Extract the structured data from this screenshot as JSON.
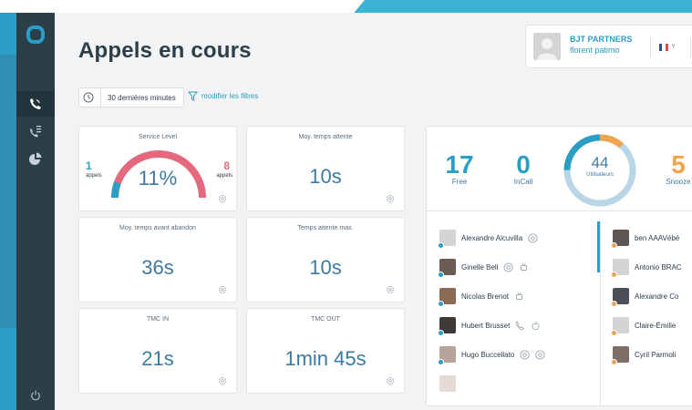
{
  "page": {
    "title": "Appels en cours",
    "filter_period": "30 dernières minutes",
    "filter_link": "modifier les filtres"
  },
  "account": {
    "company": "BJT PARTNERS",
    "user": "florent patimo",
    "language_flag": "flag-fr-icon"
  },
  "sidebar": {
    "items": [
      {
        "name": "phone-calls-icon",
        "active": true
      },
      {
        "name": "call-list-icon",
        "active": false
      },
      {
        "name": "pie-chart-icon",
        "active": false
      }
    ],
    "bottom": "power-icon"
  },
  "stats": {
    "service_level": {
      "title": "Service Level",
      "value": "11%",
      "left_count": "1",
      "left_label": "appels",
      "right_count": "8",
      "right_label": "appels",
      "fraction": 0.11
    },
    "avg_wait": {
      "title": "Moy. temps attente",
      "value": "10s"
    },
    "avg_before_abandon": {
      "title": "Moy. temps avant abandon",
      "value": "36s"
    },
    "max_wait": {
      "title": "Temps attente max.",
      "value": "10s"
    },
    "tmc_in": {
      "title": "TMC IN",
      "value": "21s"
    },
    "tmc_out": {
      "title": "TMC OUT",
      "value": "1min 45s"
    }
  },
  "users_summary": {
    "free": {
      "count": "17",
      "label": "Free"
    },
    "incall": {
      "count": "0",
      "label": "InCall"
    },
    "total": {
      "count": "44",
      "label": "Utilisateurs"
    },
    "snooze": {
      "count": "5",
      "label": "Snooze"
    },
    "colors": {
      "free": "#2a9ec4",
      "snooze": "#f2a34e",
      "ring_rest": "#b9d6e6"
    }
  },
  "users_left": [
    {
      "name": "Alexandre Alcuvilla",
      "status": "#2a9ec4",
      "avatar": "placeholder",
      "icons": [
        "chrome-icon"
      ]
    },
    {
      "name": "Ginelle Bell",
      "status": "#2a9ec4",
      "avatar": "photo",
      "icons": [
        "chrome-icon",
        "android-icon"
      ]
    },
    {
      "name": "Nicolas Brenot",
      "status": "#2a9ec4",
      "avatar": "photo",
      "icons": [
        "android-icon"
      ]
    },
    {
      "name": "Hubert Brusset",
      "status": "#2a9ec4",
      "avatar": "photo",
      "icons": [
        "desk-phone-icon",
        "apple-icon"
      ]
    },
    {
      "name": "Hugo Buccellato",
      "status": "#2a9ec4",
      "avatar": "photo",
      "icons": [
        "chrome-icon",
        "chrome-icon"
      ]
    }
  ],
  "users_right": [
    {
      "name": "ben AAAVébé",
      "status": "#f2a34e",
      "avatar": "photo"
    },
    {
      "name": "Antonio BRAC",
      "status": "#f2a34e",
      "avatar": "placeholder"
    },
    {
      "name": "Alexandre Co",
      "status": "#f2a34e",
      "avatar": "photo"
    },
    {
      "name": "Claire-Émilie",
      "status": "#f2a34e",
      "avatar": "placeholder"
    },
    {
      "name": "Cyril Parmoli",
      "status": "#f2a34e",
      "avatar": "photo"
    }
  ]
}
